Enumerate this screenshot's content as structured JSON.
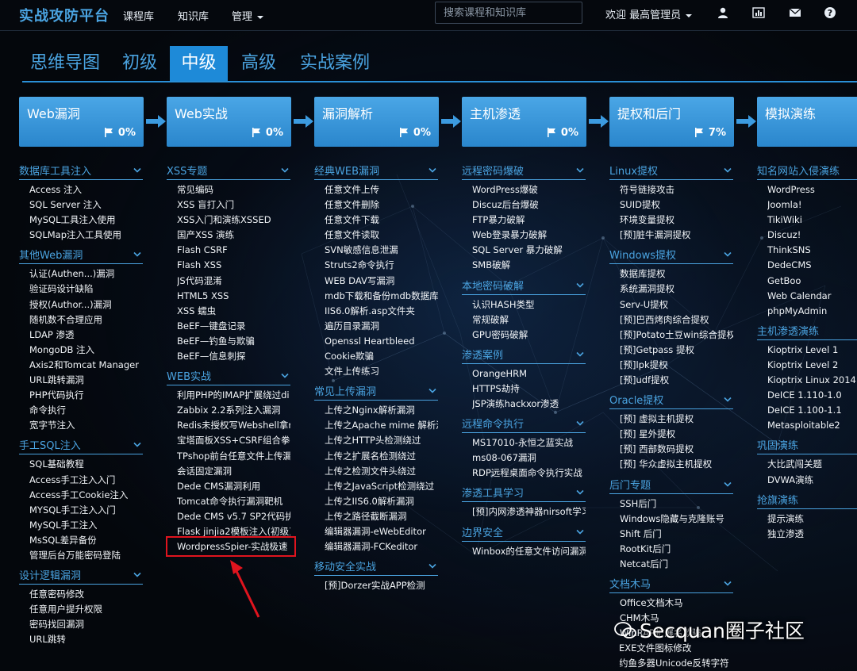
{
  "header": {
    "brand": "实战攻防平台",
    "nav": [
      "课程库",
      "知识库",
      "管理"
    ],
    "search_placeholder": "搜索课程和知识库",
    "welcome": "欢迎 最高管理员",
    "icons": [
      "user-icon",
      "chart-icon",
      "mail-icon",
      "help-icon"
    ]
  },
  "tabs": [
    "思维导图",
    "初级",
    "中级",
    "高级",
    "实战案例"
  ],
  "active_tab": "中级",
  "colors": {
    "accent": "#4aa3e0",
    "card": "#2a86cc",
    "highlight": "#e0141e"
  },
  "cards": [
    {
      "title": "Web漏洞",
      "pct": "0%"
    },
    {
      "title": "Web实战",
      "pct": "0%"
    },
    {
      "title": "漏洞解析",
      "pct": "0%"
    },
    {
      "title": "主机渗透",
      "pct": "0%"
    },
    {
      "title": "提权和后门",
      "pct": "7%"
    },
    {
      "title": "模拟演练",
      "pct": ""
    }
  ],
  "columns": [
    {
      "sections": [
        {
          "title": "数据库工具注入",
          "items": [
            "Access 注入",
            "SQL Server 注入",
            "MySQL工具注入使用",
            "SQLMap注入工具使用"
          ]
        },
        {
          "title": "其他Web漏洞",
          "items": [
            "认证(Authen...)漏洞",
            "验证码设计缺陷",
            "授权(Author...)漏洞",
            "随机数不合理应用",
            "LDAP 渗透",
            "MongoDB 注入",
            "Axis2和Tomcat Manager",
            "URL跳转漏洞",
            "PHP代码执行",
            "命令执行",
            "宽字节注入"
          ]
        },
        {
          "title": "手工SQL注入",
          "items": [
            "SQL基础教程",
            "Access手工注入入门",
            "Access手工Cookie注入",
            "MYSQL手工注入入门",
            "MySQL手工注入",
            "MsSQL差异备份",
            "管理后台万能密码登陆"
          ]
        },
        {
          "title": "设计逻辑漏洞",
          "items": [
            "任意密码修改",
            "任意用户提升权限",
            "密码找回漏洞",
            "URL跳转"
          ]
        }
      ]
    },
    {
      "sections": [
        {
          "title": "XSS专题",
          "items": [
            "常见编码",
            "XSS 盲打入门",
            "XSS入门和演练XSSED",
            "国产XSS 演练",
            "Flash CSRF",
            "Flash XSS",
            "JS代码混淆",
            "HTML5 XSS",
            "XSS 蠕虫",
            "BeEF—键盘记录",
            "BeEF—钓鱼与欺骗",
            "BeEF—信息刺探"
          ]
        },
        {
          "title": "WEB实战",
          "items": [
            "利用PHP的IMAP扩展绕过di",
            "Zabbix 2.2系列注入漏洞",
            "Redis未授权写Webshell拿r",
            "宝塔面板XSS+CSRF组合拳",
            "TPshop前台任意文件上传漏",
            "会话固定漏洞",
            "Dede CMS漏洞利用",
            "Tomcat命令执行漏洞靶机",
            "Dede CMS v5.7 SP2代码执",
            "Flask jinjia2模板注入(初级)",
            "WordpressSpier-实战极速"
          ]
        }
      ]
    },
    {
      "sections": [
        {
          "title": "经典WEB漏洞",
          "items": [
            "任意文件上传",
            "任意文件删除",
            "任意文件下载",
            "任意文件读取",
            "SVN敏感信息泄漏",
            "Struts2命令执行",
            "WEB DAV写漏洞",
            "mdb下载和备份mdb数据库",
            "IIS6.0解析.asp文件夹",
            "遍历目录漏洞",
            "Openssl Heartbleed",
            "Cookie欺骗",
            "文件上传练习"
          ]
        },
        {
          "title": "常见上传漏洞",
          "items": [
            "上传之Nginx解析漏洞",
            "上传之Apache mime 解析漏",
            "上传之HTTP头检测绕过",
            "上传之扩展名检测绕过",
            "上传之检测文件头绕过",
            "上传之JavaScript检测绕过",
            "上传之IIS6.0解析漏洞",
            "上传之路径截断漏洞",
            "编辑器漏洞-eWebEditor",
            "编辑器漏洞-FCKeditor"
          ]
        },
        {
          "title": "移动安全实战",
          "items": [
            "[预]Dorzer实战APP检测"
          ]
        }
      ]
    },
    {
      "sections": [
        {
          "title": "远程密码爆破",
          "items": [
            "WordPress爆破",
            "Discuz后台爆破",
            "FTP暴力破解",
            "Web登录暴力破解",
            "SQL Server 暴力破解",
            "SMB破解"
          ]
        },
        {
          "title": "本地密码破解",
          "items": [
            "认识HASH类型",
            "常规破解",
            "GPU密码破解"
          ]
        },
        {
          "title": "渗透案例",
          "items": [
            "OrangeHRM",
            "HTTPS劫持",
            "JSP演练hackxor渗透"
          ]
        },
        {
          "title": "远程命令执行",
          "items": [
            "MS17010-永恒之蓝实战",
            "ms08-067漏洞",
            "RDP远程桌面命令执行实战"
          ]
        },
        {
          "title": "渗透工具学习",
          "items": [
            "[预]内网渗透神器nirsoft学习"
          ]
        },
        {
          "title": "边界安全",
          "items": [
            "Winbox的任意文件访问漏洞"
          ]
        }
      ]
    },
    {
      "sections": [
        {
          "title": "Linux提权",
          "items": [
            "符号链接攻击",
            "SUID提权",
            "环境变量提权",
            "[预]脏牛漏洞提权"
          ]
        },
        {
          "title": "Windows提权",
          "items": [
            "数据库提权",
            "系统漏洞提权",
            "Serv-U提权",
            "[预]巴西烤肉综合提权",
            "[预]Potato土豆win综合提权",
            "[预]Getpass 提权",
            "[预]lpk提权",
            "[预]udf提权"
          ]
        },
        {
          "title": "Oracle提权",
          "items": [
            "[预] 虚拟主机提权",
            "[预] 星外提权",
            "[预] 西部数码提权",
            "[预] 华众虚拟主机提权"
          ]
        },
        {
          "title": "后门专题",
          "items": [
            "SSH后门",
            "Windows隐藏与克隆账号",
            "Shift 后门",
            "RootKit后门",
            "Netcat后门"
          ]
        },
        {
          "title": "文档木马",
          "items": [
            "Office文档木马",
            "CHM木马",
            "WinRAR扩展名欺骗",
            "EXE文件图标修改",
            "约鱼多器Unicode反转字符"
          ]
        }
      ]
    },
    {
      "sections": [
        {
          "title": "知名网站入侵演练",
          "items": [
            "WordPress",
            "Joomla!",
            "TikiWiki",
            "Discuz!",
            "ThinkSNS",
            "DedeCMS",
            "GetBoo",
            "Web Calendar",
            "phpMyAdmin"
          ]
        },
        {
          "title": "主机渗透演练",
          "items": [
            "Kioptrix Level 1",
            "Kioptrix Level 2",
            "Kioptrix Linux 2014",
            "DeICE 1.110-1.0",
            "DeICE 1.100-1.1",
            "Metasploitable2"
          ]
        },
        {
          "title": "巩固演练",
          "items": [
            "大比武闯关题",
            "DVWA演练"
          ]
        },
        {
          "title": "抢旗演练",
          "items": [
            "提示演练",
            "独立渗透"
          ]
        }
      ]
    }
  ],
  "watermark": "Secquan圈子社区"
}
